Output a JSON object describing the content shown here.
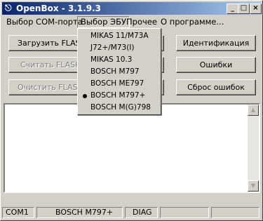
{
  "window": {
    "title": "OpenBox - 3.1.9.3",
    "app_icon": "openbox-icon"
  },
  "title_buttons": {
    "minimize": "_",
    "maximize": "□",
    "close": "×"
  },
  "menu": {
    "items": [
      {
        "label": "Выбор COM-порта"
      },
      {
        "label": "Выбор ЭБУ"
      },
      {
        "label": "Прочее"
      },
      {
        "label": "О программе..."
      }
    ]
  },
  "buttons": {
    "load_flash": "Загрузить FLASH",
    "read_flash": "Считать FLASH",
    "clear_flash": "Очистить FLASH",
    "identify": "Идентификация",
    "errors": "Ошибки",
    "reset_errors": "Сброс ошибок"
  },
  "ecu_menu": {
    "items": [
      {
        "label": "MIKAS 11/M73A",
        "selected": false
      },
      {
        "label": "J72+/M73(I)",
        "selected": false
      },
      {
        "label": "MIKAS 10.3",
        "selected": false
      },
      {
        "label": "BOSCH M797",
        "selected": false
      },
      {
        "label": "BOSCH ME797",
        "selected": false
      },
      {
        "label": "BOSCH M797+",
        "selected": true
      },
      {
        "label": "BOSCH M(G)798",
        "selected": false
      }
    ]
  },
  "log": {
    "text": ""
  },
  "status": {
    "port": "COM1",
    "ecu": "BOSCH M797+",
    "mode": "DIAG",
    "p4": "",
    "p5": ""
  }
}
